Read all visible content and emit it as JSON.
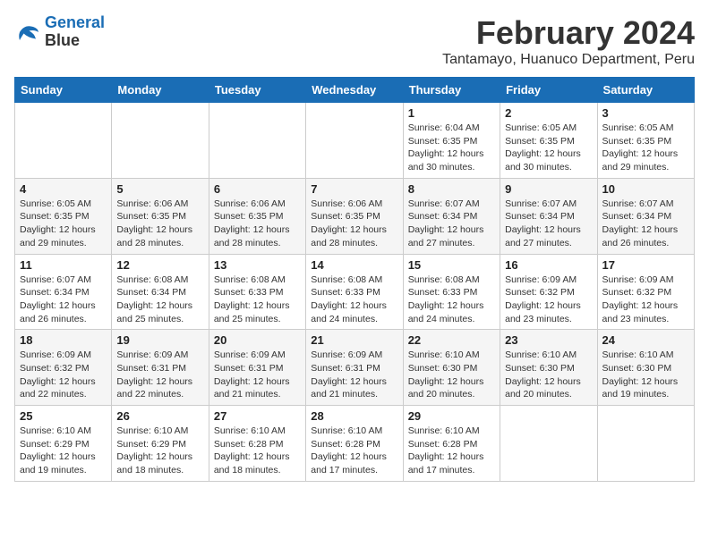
{
  "logo": {
    "line1": "General",
    "line2": "Blue"
  },
  "title": "February 2024",
  "location": "Tantamayo, Huanuco Department, Peru",
  "days_of_week": [
    "Sunday",
    "Monday",
    "Tuesday",
    "Wednesday",
    "Thursday",
    "Friday",
    "Saturday"
  ],
  "weeks": [
    [
      {
        "day": "",
        "info": ""
      },
      {
        "day": "",
        "info": ""
      },
      {
        "day": "",
        "info": ""
      },
      {
        "day": "",
        "info": ""
      },
      {
        "day": "1",
        "info": "Sunrise: 6:04 AM\nSunset: 6:35 PM\nDaylight: 12 hours and 30 minutes."
      },
      {
        "day": "2",
        "info": "Sunrise: 6:05 AM\nSunset: 6:35 PM\nDaylight: 12 hours and 30 minutes."
      },
      {
        "day": "3",
        "info": "Sunrise: 6:05 AM\nSunset: 6:35 PM\nDaylight: 12 hours and 29 minutes."
      }
    ],
    [
      {
        "day": "4",
        "info": "Sunrise: 6:05 AM\nSunset: 6:35 PM\nDaylight: 12 hours and 29 minutes."
      },
      {
        "day": "5",
        "info": "Sunrise: 6:06 AM\nSunset: 6:35 PM\nDaylight: 12 hours and 28 minutes."
      },
      {
        "day": "6",
        "info": "Sunrise: 6:06 AM\nSunset: 6:35 PM\nDaylight: 12 hours and 28 minutes."
      },
      {
        "day": "7",
        "info": "Sunrise: 6:06 AM\nSunset: 6:35 PM\nDaylight: 12 hours and 28 minutes."
      },
      {
        "day": "8",
        "info": "Sunrise: 6:07 AM\nSunset: 6:34 PM\nDaylight: 12 hours and 27 minutes."
      },
      {
        "day": "9",
        "info": "Sunrise: 6:07 AM\nSunset: 6:34 PM\nDaylight: 12 hours and 27 minutes."
      },
      {
        "day": "10",
        "info": "Sunrise: 6:07 AM\nSunset: 6:34 PM\nDaylight: 12 hours and 26 minutes."
      }
    ],
    [
      {
        "day": "11",
        "info": "Sunrise: 6:07 AM\nSunset: 6:34 PM\nDaylight: 12 hours and 26 minutes."
      },
      {
        "day": "12",
        "info": "Sunrise: 6:08 AM\nSunset: 6:34 PM\nDaylight: 12 hours and 25 minutes."
      },
      {
        "day": "13",
        "info": "Sunrise: 6:08 AM\nSunset: 6:33 PM\nDaylight: 12 hours and 25 minutes."
      },
      {
        "day": "14",
        "info": "Sunrise: 6:08 AM\nSunset: 6:33 PM\nDaylight: 12 hours and 24 minutes."
      },
      {
        "day": "15",
        "info": "Sunrise: 6:08 AM\nSunset: 6:33 PM\nDaylight: 12 hours and 24 minutes."
      },
      {
        "day": "16",
        "info": "Sunrise: 6:09 AM\nSunset: 6:32 PM\nDaylight: 12 hours and 23 minutes."
      },
      {
        "day": "17",
        "info": "Sunrise: 6:09 AM\nSunset: 6:32 PM\nDaylight: 12 hours and 23 minutes."
      }
    ],
    [
      {
        "day": "18",
        "info": "Sunrise: 6:09 AM\nSunset: 6:32 PM\nDaylight: 12 hours and 22 minutes."
      },
      {
        "day": "19",
        "info": "Sunrise: 6:09 AM\nSunset: 6:31 PM\nDaylight: 12 hours and 22 minutes."
      },
      {
        "day": "20",
        "info": "Sunrise: 6:09 AM\nSunset: 6:31 PM\nDaylight: 12 hours and 21 minutes."
      },
      {
        "day": "21",
        "info": "Sunrise: 6:09 AM\nSunset: 6:31 PM\nDaylight: 12 hours and 21 minutes."
      },
      {
        "day": "22",
        "info": "Sunrise: 6:10 AM\nSunset: 6:30 PM\nDaylight: 12 hours and 20 minutes."
      },
      {
        "day": "23",
        "info": "Sunrise: 6:10 AM\nSunset: 6:30 PM\nDaylight: 12 hours and 20 minutes."
      },
      {
        "day": "24",
        "info": "Sunrise: 6:10 AM\nSunset: 6:30 PM\nDaylight: 12 hours and 19 minutes."
      }
    ],
    [
      {
        "day": "25",
        "info": "Sunrise: 6:10 AM\nSunset: 6:29 PM\nDaylight: 12 hours and 19 minutes."
      },
      {
        "day": "26",
        "info": "Sunrise: 6:10 AM\nSunset: 6:29 PM\nDaylight: 12 hours and 18 minutes."
      },
      {
        "day": "27",
        "info": "Sunrise: 6:10 AM\nSunset: 6:28 PM\nDaylight: 12 hours and 18 minutes."
      },
      {
        "day": "28",
        "info": "Sunrise: 6:10 AM\nSunset: 6:28 PM\nDaylight: 12 hours and 17 minutes."
      },
      {
        "day": "29",
        "info": "Sunrise: 6:10 AM\nSunset: 6:28 PM\nDaylight: 12 hours and 17 minutes."
      },
      {
        "day": "",
        "info": ""
      },
      {
        "day": "",
        "info": ""
      }
    ]
  ]
}
